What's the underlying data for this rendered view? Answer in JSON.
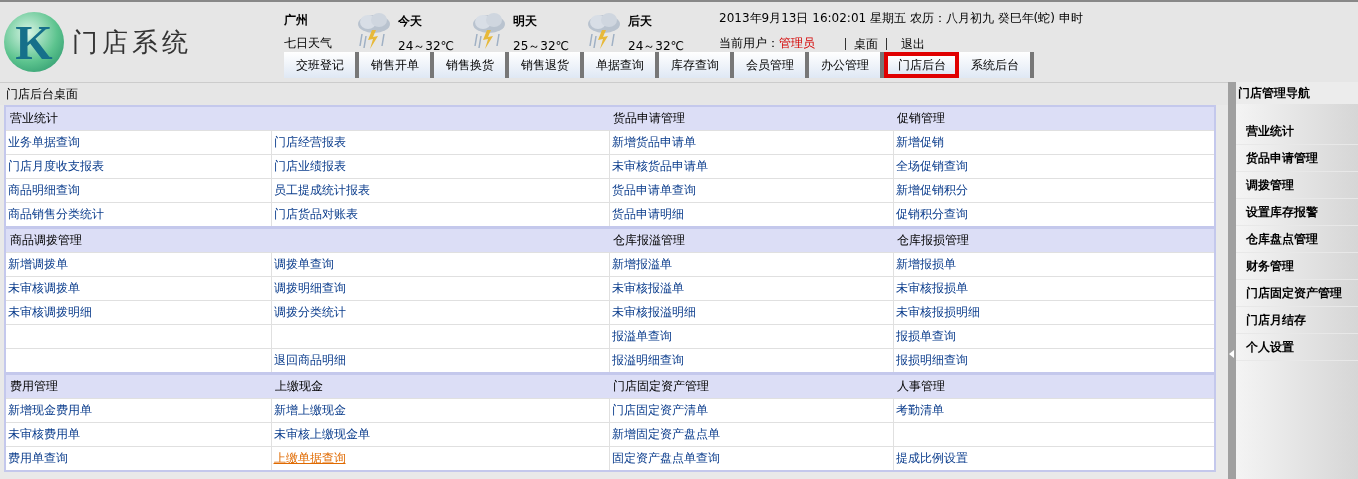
{
  "logo": {
    "letter": "K",
    "title": "门店系统"
  },
  "weather": {
    "city": "广州",
    "link": "七日天气",
    "days": [
      {
        "label": "今天",
        "temp": "24～32℃"
      },
      {
        "label": "明天",
        "temp": "25～32℃"
      },
      {
        "label": "后天",
        "temp": "24～32℃"
      }
    ]
  },
  "datetime": "2013年9月13日  16:02:01 星期五  农历：八月初九  癸巳年(蛇) 申时",
  "user": {
    "label": "当前用户：",
    "name": "管理员"
  },
  "header_links": [
    "桌面",
    "退出"
  ],
  "tabs": [
    {
      "label": "交班登记",
      "selected": false
    },
    {
      "label": "销售开单",
      "selected": false
    },
    {
      "label": "销售换货",
      "selected": false
    },
    {
      "label": "销售退货",
      "selected": false
    },
    {
      "label": "单据查询",
      "selected": false
    },
    {
      "label": "库存查询",
      "selected": false
    },
    {
      "label": "会员管理",
      "selected": false
    },
    {
      "label": "办公管理",
      "selected": false
    },
    {
      "label": "门店后台",
      "selected": true
    },
    {
      "label": "系统后台",
      "selected": false
    }
  ],
  "panel_title": "门店后台桌面",
  "groups": [
    {
      "headers": [
        "营业统计",
        "货品申请管理",
        "促销管理"
      ],
      "rows": [
        [
          {
            "text": "业务单据查询",
            "hovered": false
          },
          {
            "text": "门店经营报表",
            "hovered": false
          },
          {
            "text": "新增货品申请单",
            "hovered": false
          },
          {
            "text": "新增促销",
            "hovered": false
          }
        ],
        [
          {
            "text": "门店月度收支报表",
            "hovered": false
          },
          {
            "text": "门店业绩报表",
            "hovered": false
          },
          {
            "text": "未审核货品申请单",
            "hovered": false
          },
          {
            "text": "全场促销查询",
            "hovered": false
          }
        ],
        [
          {
            "text": "商品明细查询",
            "hovered": false
          },
          {
            "text": "员工提成统计报表",
            "hovered": false
          },
          {
            "text": "货品申请单查询",
            "hovered": false
          },
          {
            "text": "新增促销积分",
            "hovered": false
          }
        ],
        [
          {
            "text": "商品销售分类统计",
            "hovered": false
          },
          {
            "text": "门店货品对账表",
            "hovered": false
          },
          {
            "text": "货品申请明细",
            "hovered": false
          },
          {
            "text": "促销积分查询",
            "hovered": false
          }
        ]
      ]
    },
    {
      "headers": [
        "商品调拨管理",
        "仓库报溢管理",
        "仓库报损管理"
      ],
      "rows": [
        [
          {
            "text": "新增调拨单",
            "hovered": false
          },
          {
            "text": "调拨单查询",
            "hovered": false
          },
          {
            "text": "新增报溢单",
            "hovered": false
          },
          {
            "text": "新增报损单",
            "hovered": false
          }
        ],
        [
          {
            "text": "未审核调拨单",
            "hovered": false
          },
          {
            "text": "调拨明细查询",
            "hovered": false
          },
          {
            "text": "未审核报溢单",
            "hovered": false
          },
          {
            "text": "未审核报损单",
            "hovered": false
          }
        ],
        [
          {
            "text": "未审核调拨明细",
            "hovered": false
          },
          {
            "text": "调拨分类统计",
            "hovered": false
          },
          {
            "text": "未审核报溢明细",
            "hovered": false
          },
          {
            "text": "未审核报损明细",
            "hovered": false
          }
        ],
        [
          null,
          null,
          {
            "text": "报溢单查询",
            "hovered": false
          },
          {
            "text": "报损单查询",
            "hovered": false
          }
        ],
        [
          null,
          {
            "text": "退回商品明细",
            "hovered": false
          },
          {
            "text": "报溢明细查询",
            "hovered": false
          },
          {
            "text": "报损明细查询",
            "hovered": false
          }
        ]
      ]
    },
    {
      "headers": [
        "费用管理",
        "上缴现金",
        "门店固定资产管理",
        "人事管理"
      ],
      "rows": [
        [
          {
            "text": "新增现金费用单",
            "hovered": false
          },
          {
            "text": "新增上缴现金",
            "hovered": false
          },
          {
            "text": "门店固定资产清单",
            "hovered": false
          },
          {
            "text": "考勤清单",
            "hovered": false
          }
        ],
        [
          {
            "text": "未审核费用单",
            "hovered": false
          },
          {
            "text": "未审核上缴现金单",
            "hovered": false
          },
          {
            "text": "新增固定资产盘点单",
            "hovered": false
          },
          null
        ],
        [
          {
            "text": "费用单查询",
            "hovered": false
          },
          {
            "text": "上缴单据查询",
            "hovered": true
          },
          {
            "text": "固定资产盘点单查询",
            "hovered": false
          },
          {
            "text": "提成比例设置",
            "hovered": false
          }
        ]
      ]
    }
  ],
  "sidebar": {
    "title": "门店管理导航",
    "items": [
      "营业统计",
      "货品申请管理",
      "调拨管理",
      "设置库存报警",
      "仓库盘点管理",
      "财务管理",
      "门店固定资产管理",
      "门店月结存",
      "个人设置"
    ]
  }
}
